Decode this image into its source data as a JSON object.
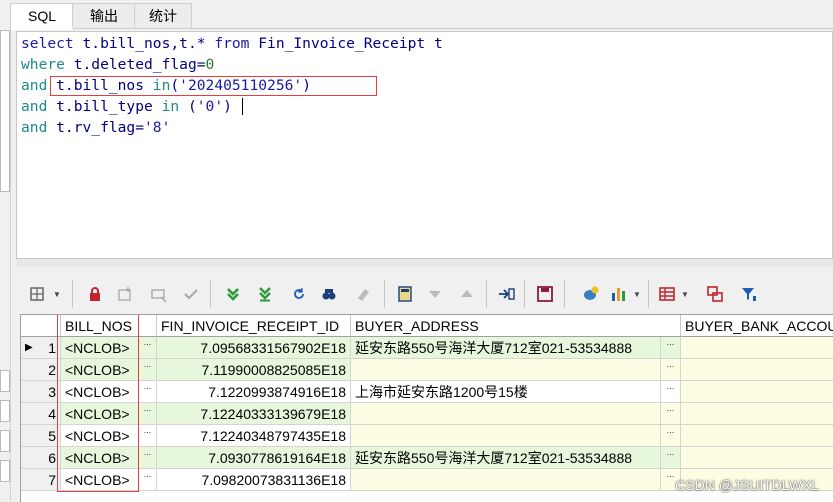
{
  "tabs": [
    {
      "label": "SQL",
      "active": true
    },
    {
      "label": "输出",
      "active": false
    },
    {
      "label": "统计",
      "active": false
    }
  ],
  "sql": {
    "line1": {
      "kw1": "select",
      "t1": " t.bill_nos,t.* ",
      "kw2": "from",
      "t2": " Fin_Invoice_Receipt t"
    },
    "line2": {
      "kw1": "where",
      "t1": " t.deleted_flag=",
      "n": "0"
    },
    "line3": {
      "kw1": "and",
      "t1": " t.bill_nos ",
      "kw2": "in",
      "t2": "(",
      "s": "'202405110256'",
      "t3": ")"
    },
    "line4": {
      "kw1": "and",
      "t1": " t.bill_type ",
      "kw2": "in",
      "t2": " (",
      "s": "'0'",
      "t3": ")"
    },
    "line5": {
      "kw1": "and",
      "t1": " t.rv_flag=",
      "s": "'8'"
    }
  },
  "toolbar": {
    "icons": [
      "grid-options-icon",
      "lock-icon",
      "add-record-icon",
      "delete-record-icon",
      "post-changes-icon",
      "fetch-next-icon",
      "fetch-last-icon",
      "refresh-icon",
      "query-by-example-icon",
      "clear-record-icon",
      "save-to-file-icon",
      "previous-record-icon",
      "next-record-icon",
      "export-icon",
      "save-icon",
      "connect-icon",
      "chart-icon",
      "table-view-icon",
      "compare-icon",
      "filter-icon"
    ],
    "accent_green": "#2e9a3a",
    "accent_red": "#c0272d"
  },
  "grid": {
    "columns": [
      "BILL_NOS",
      "FIN_INVOICE_RECEIPT_ID",
      "BUYER_ADDRESS",
      "BUYER_BANK_ACCOUN"
    ],
    "rows": [
      {
        "n": "1",
        "bill": "<NCLOB>",
        "id": "7.09568331567902E18",
        "addr": "延安东路550号海洋大厦712室021-53534888"
      },
      {
        "n": "2",
        "bill": "<NCLOB>",
        "id": "7.11990008825085E18",
        "addr": ""
      },
      {
        "n": "3",
        "bill": "<NCLOB>",
        "id": "7.1220993874916E18",
        "addr": "上海市延安东路1200号15楼"
      },
      {
        "n": "4",
        "bill": "<NCLOB>",
        "id": "7.12240333139679E18",
        "addr": ""
      },
      {
        "n": "5",
        "bill": "<NCLOB>",
        "id": "7.12240348797435E18",
        "addr": ""
      },
      {
        "n": "6",
        "bill": "<NCLOB>",
        "id": "7.0930778619164E18",
        "addr": "延安东路550号海洋大厦712室021-53534888"
      },
      {
        "n": "7",
        "bill": "<NCLOB>",
        "id": "7.09820073831136E18",
        "addr": ""
      }
    ],
    "ellipsis": "..."
  },
  "watermark": "CSDN @JSUITDLWXL"
}
